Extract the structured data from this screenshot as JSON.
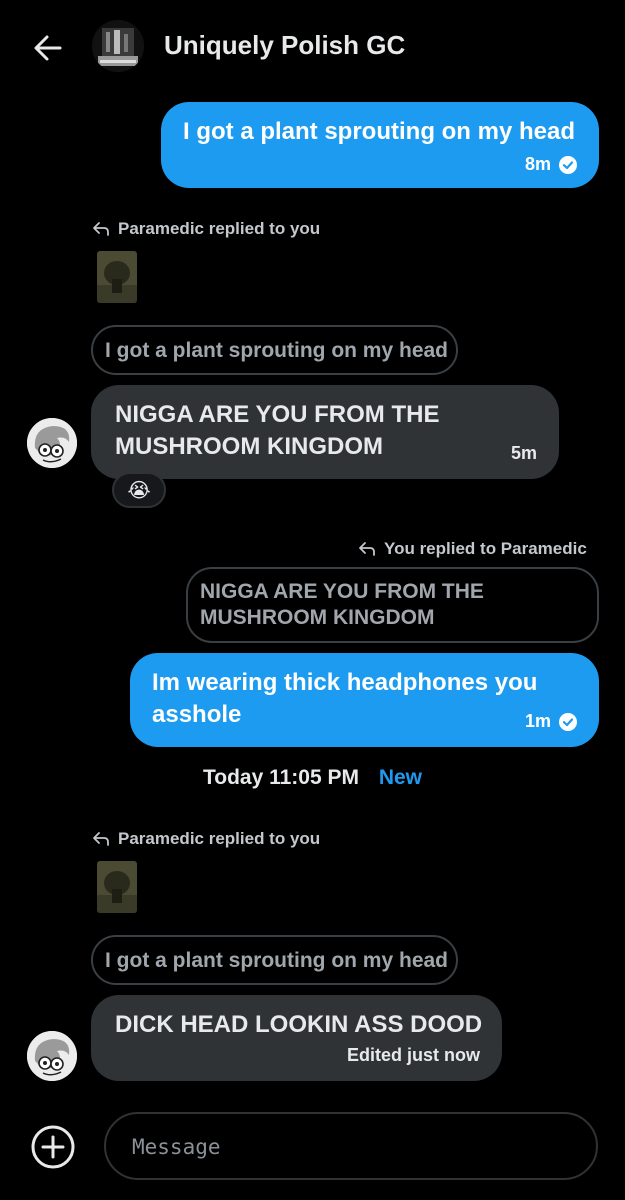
{
  "header": {
    "title": "Uniquely Polish GC",
    "back_icon": "arrow-left-icon"
  },
  "messages": {
    "m1": {
      "text": "I got a plant sprouting on my head",
      "time": "8m"
    },
    "r1": {
      "reply_header": "Paramedic replied to you",
      "quote": "I got a plant sprouting on my head",
      "line1": "NIGGA ARE YOU FROM THE",
      "line2": "MUSHROOM KINGDOM",
      "time": "5m",
      "reaction": "😭"
    },
    "m2": {
      "reply_header": "You replied to Paramedic",
      "quote_line1": "NIGGA ARE YOU FROM THE",
      "quote_line2": "MUSHROOM KINGDOM",
      "line1": "Im wearing thick headphones you",
      "line2": "asshole",
      "time": "1m"
    },
    "divider": {
      "when": "Today 11:05 PM",
      "new_label": "New"
    },
    "r2": {
      "reply_header": "Paramedic replied to you",
      "quote": "I got a plant sprouting on my head",
      "text": "DICK HEAD LOOKIN ASS DOOD",
      "status": "Edited just now"
    }
  },
  "composer": {
    "placeholder": "Message",
    "add_icon": "plus-circle-icon"
  },
  "colors": {
    "background": "#000000",
    "outgoing_bubble": "#1d9bf0",
    "incoming_bubble": "#2f3336",
    "accent": "#1d9bf0"
  }
}
